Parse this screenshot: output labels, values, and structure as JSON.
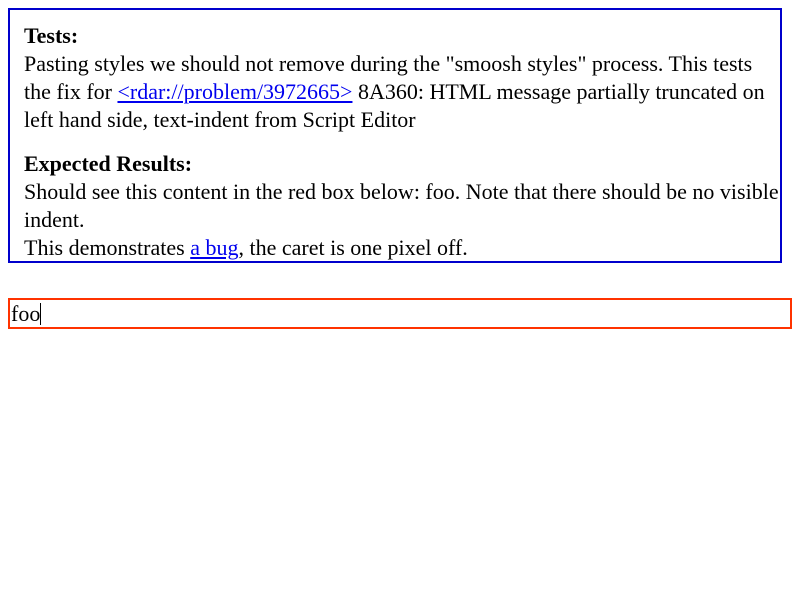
{
  "tests": {
    "heading": "Tests:",
    "text_before_link": "Pasting styles we should not remove during the \"smoosh styles\" process. This tests the fix for ",
    "link_text": "<rdar://problem/3972665>",
    "text_after_link": " 8A360: HTML message partially truncated on left hand side, text-indent from Script Editor"
  },
  "expected": {
    "heading": "Expected Results:",
    "line1": "Should see this content in the red box below: foo. Note that there should be no visible indent.",
    "line2_before_link": "This demonstrates ",
    "link_text": "a bug",
    "line2_after_link": ", the caret is one pixel off."
  },
  "editable": {
    "content": "foo"
  },
  "colors": {
    "explanation_border": "#0000cc",
    "test_border": "#ff3300",
    "link": "#0000ee"
  }
}
